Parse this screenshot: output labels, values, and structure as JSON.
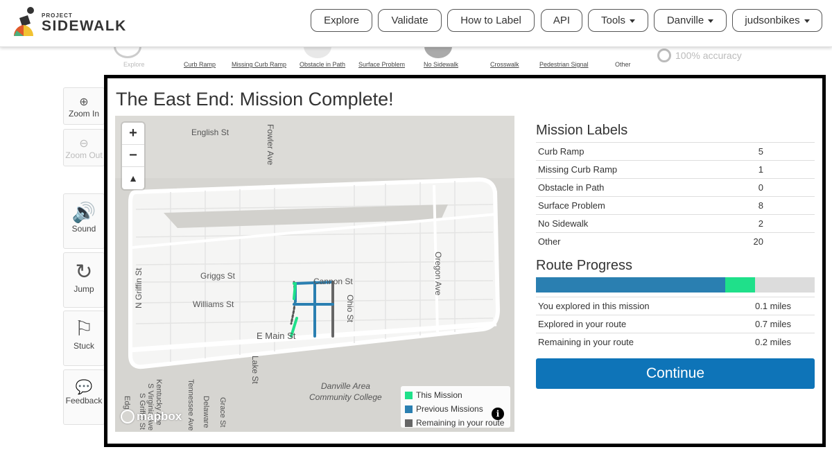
{
  "brand": {
    "small": "PROJECT",
    "big": "SIDEWALK"
  },
  "nav": {
    "items": [
      {
        "label": "Explore",
        "dropdown": false
      },
      {
        "label": "Validate",
        "dropdown": false
      },
      {
        "label": "How to Label",
        "dropdown": false
      },
      {
        "label": "API",
        "dropdown": false
      },
      {
        "label": "Tools",
        "dropdown": true
      },
      {
        "label": "Danville",
        "dropdown": true
      },
      {
        "label": "judsonbikes",
        "dropdown": true
      }
    ]
  },
  "label_strip": {
    "items": [
      "Explore",
      "Curb Ramp",
      "Missing Curb Ramp",
      "Obstacle in Path",
      "Surface Problem",
      "No Sidewalk",
      "Crosswalk",
      "Pedestrian Signal",
      "Other"
    ]
  },
  "accuracy": "100% accuracy",
  "tools": {
    "zoom_in": "Zoom In",
    "zoom_out": "Zoom Out",
    "sound": "Sound",
    "jump": "Jump",
    "stuck": "Stuck",
    "feedback": "Feedback"
  },
  "modal": {
    "title": "The East End: Mission Complete!",
    "map": {
      "streets": [
        "English St",
        "Fowler Ave",
        "N Griffin St",
        "Griggs St",
        "Williams St",
        "Cannon St",
        "Ohio St",
        "E Main St",
        "Oregon Ave",
        "Lake St",
        "Tennessee Ave",
        "Kentucky Ave",
        "S Virginia Ave",
        "Delaware",
        "Grace St",
        "Edg",
        "S Griffin St"
      ],
      "poi": [
        "Danville Area",
        "Community College"
      ],
      "legend": [
        "This Mission",
        "Previous Missions",
        "Remaining in your route"
      ],
      "attribution": "mapbox",
      "info_icon": "i"
    },
    "mission_labels": {
      "title": "Mission Labels",
      "rows": [
        {
          "label": "Curb Ramp",
          "count": "5"
        },
        {
          "label": "Missing Curb Ramp",
          "count": "1"
        },
        {
          "label": "Obstacle in Path",
          "count": "0"
        },
        {
          "label": "Surface Problem",
          "count": "8"
        },
        {
          "label": "No Sidewalk",
          "count": "2"
        },
        {
          "label": "Other",
          "count": "20"
        }
      ]
    },
    "route_progress": {
      "title": "Route Progress",
      "previous_fraction": 0.68,
      "this_mission_fraction": 0.107,
      "rows": [
        {
          "label": "You explored in this mission",
          "value": "0.1 miles"
        },
        {
          "label": "Explored in your route",
          "value": "0.7 miles"
        },
        {
          "label": "Remaining in your route",
          "value": "0.2 miles"
        }
      ]
    },
    "continue_label": "Continue"
  },
  "colors": {
    "this_mission": "#1fe08a",
    "previous_missions": "#2a7fb1",
    "remaining": "#666666",
    "continue_button": "#0e74b8"
  }
}
